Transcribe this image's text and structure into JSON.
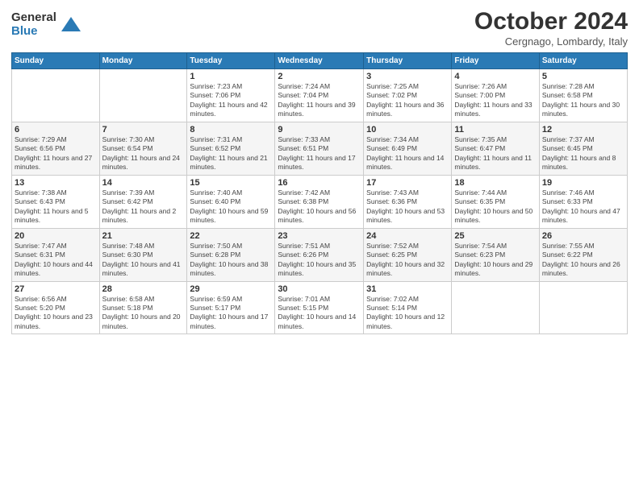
{
  "header": {
    "logo_general": "General",
    "logo_blue": "Blue",
    "month_title": "October 2024",
    "location": "Cergnago, Lombardy, Italy"
  },
  "weekdays": [
    "Sunday",
    "Monday",
    "Tuesday",
    "Wednesday",
    "Thursday",
    "Friday",
    "Saturday"
  ],
  "weeks": [
    [
      {
        "day": "",
        "sunrise": "",
        "sunset": "",
        "daylight": ""
      },
      {
        "day": "",
        "sunrise": "",
        "sunset": "",
        "daylight": ""
      },
      {
        "day": "1",
        "sunrise": "Sunrise: 7:23 AM",
        "sunset": "Sunset: 7:06 PM",
        "daylight": "Daylight: 11 hours and 42 minutes."
      },
      {
        "day": "2",
        "sunrise": "Sunrise: 7:24 AM",
        "sunset": "Sunset: 7:04 PM",
        "daylight": "Daylight: 11 hours and 39 minutes."
      },
      {
        "day": "3",
        "sunrise": "Sunrise: 7:25 AM",
        "sunset": "Sunset: 7:02 PM",
        "daylight": "Daylight: 11 hours and 36 minutes."
      },
      {
        "day": "4",
        "sunrise": "Sunrise: 7:26 AM",
        "sunset": "Sunset: 7:00 PM",
        "daylight": "Daylight: 11 hours and 33 minutes."
      },
      {
        "day": "5",
        "sunrise": "Sunrise: 7:28 AM",
        "sunset": "Sunset: 6:58 PM",
        "daylight": "Daylight: 11 hours and 30 minutes."
      }
    ],
    [
      {
        "day": "6",
        "sunrise": "Sunrise: 7:29 AM",
        "sunset": "Sunset: 6:56 PM",
        "daylight": "Daylight: 11 hours and 27 minutes."
      },
      {
        "day": "7",
        "sunrise": "Sunrise: 7:30 AM",
        "sunset": "Sunset: 6:54 PM",
        "daylight": "Daylight: 11 hours and 24 minutes."
      },
      {
        "day": "8",
        "sunrise": "Sunrise: 7:31 AM",
        "sunset": "Sunset: 6:52 PM",
        "daylight": "Daylight: 11 hours and 21 minutes."
      },
      {
        "day": "9",
        "sunrise": "Sunrise: 7:33 AM",
        "sunset": "Sunset: 6:51 PM",
        "daylight": "Daylight: 11 hours and 17 minutes."
      },
      {
        "day": "10",
        "sunrise": "Sunrise: 7:34 AM",
        "sunset": "Sunset: 6:49 PM",
        "daylight": "Daylight: 11 hours and 14 minutes."
      },
      {
        "day": "11",
        "sunrise": "Sunrise: 7:35 AM",
        "sunset": "Sunset: 6:47 PM",
        "daylight": "Daylight: 11 hours and 11 minutes."
      },
      {
        "day": "12",
        "sunrise": "Sunrise: 7:37 AM",
        "sunset": "Sunset: 6:45 PM",
        "daylight": "Daylight: 11 hours and 8 minutes."
      }
    ],
    [
      {
        "day": "13",
        "sunrise": "Sunrise: 7:38 AM",
        "sunset": "Sunset: 6:43 PM",
        "daylight": "Daylight: 11 hours and 5 minutes."
      },
      {
        "day": "14",
        "sunrise": "Sunrise: 7:39 AM",
        "sunset": "Sunset: 6:42 PM",
        "daylight": "Daylight: 11 hours and 2 minutes."
      },
      {
        "day": "15",
        "sunrise": "Sunrise: 7:40 AM",
        "sunset": "Sunset: 6:40 PM",
        "daylight": "Daylight: 10 hours and 59 minutes."
      },
      {
        "day": "16",
        "sunrise": "Sunrise: 7:42 AM",
        "sunset": "Sunset: 6:38 PM",
        "daylight": "Daylight: 10 hours and 56 minutes."
      },
      {
        "day": "17",
        "sunrise": "Sunrise: 7:43 AM",
        "sunset": "Sunset: 6:36 PM",
        "daylight": "Daylight: 10 hours and 53 minutes."
      },
      {
        "day": "18",
        "sunrise": "Sunrise: 7:44 AM",
        "sunset": "Sunset: 6:35 PM",
        "daylight": "Daylight: 10 hours and 50 minutes."
      },
      {
        "day": "19",
        "sunrise": "Sunrise: 7:46 AM",
        "sunset": "Sunset: 6:33 PM",
        "daylight": "Daylight: 10 hours and 47 minutes."
      }
    ],
    [
      {
        "day": "20",
        "sunrise": "Sunrise: 7:47 AM",
        "sunset": "Sunset: 6:31 PM",
        "daylight": "Daylight: 10 hours and 44 minutes."
      },
      {
        "day": "21",
        "sunrise": "Sunrise: 7:48 AM",
        "sunset": "Sunset: 6:30 PM",
        "daylight": "Daylight: 10 hours and 41 minutes."
      },
      {
        "day": "22",
        "sunrise": "Sunrise: 7:50 AM",
        "sunset": "Sunset: 6:28 PM",
        "daylight": "Daylight: 10 hours and 38 minutes."
      },
      {
        "day": "23",
        "sunrise": "Sunrise: 7:51 AM",
        "sunset": "Sunset: 6:26 PM",
        "daylight": "Daylight: 10 hours and 35 minutes."
      },
      {
        "day": "24",
        "sunrise": "Sunrise: 7:52 AM",
        "sunset": "Sunset: 6:25 PM",
        "daylight": "Daylight: 10 hours and 32 minutes."
      },
      {
        "day": "25",
        "sunrise": "Sunrise: 7:54 AM",
        "sunset": "Sunset: 6:23 PM",
        "daylight": "Daylight: 10 hours and 29 minutes."
      },
      {
        "day": "26",
        "sunrise": "Sunrise: 7:55 AM",
        "sunset": "Sunset: 6:22 PM",
        "daylight": "Daylight: 10 hours and 26 minutes."
      }
    ],
    [
      {
        "day": "27",
        "sunrise": "Sunrise: 6:56 AM",
        "sunset": "Sunset: 5:20 PM",
        "daylight": "Daylight: 10 hours and 23 minutes."
      },
      {
        "day": "28",
        "sunrise": "Sunrise: 6:58 AM",
        "sunset": "Sunset: 5:18 PM",
        "daylight": "Daylight: 10 hours and 20 minutes."
      },
      {
        "day": "29",
        "sunrise": "Sunrise: 6:59 AM",
        "sunset": "Sunset: 5:17 PM",
        "daylight": "Daylight: 10 hours and 17 minutes."
      },
      {
        "day": "30",
        "sunrise": "Sunrise: 7:01 AM",
        "sunset": "Sunset: 5:15 PM",
        "daylight": "Daylight: 10 hours and 14 minutes."
      },
      {
        "day": "31",
        "sunrise": "Sunrise: 7:02 AM",
        "sunset": "Sunset: 5:14 PM",
        "daylight": "Daylight: 10 hours and 12 minutes."
      },
      {
        "day": "",
        "sunrise": "",
        "sunset": "",
        "daylight": ""
      },
      {
        "day": "",
        "sunrise": "",
        "sunset": "",
        "daylight": ""
      }
    ]
  ]
}
